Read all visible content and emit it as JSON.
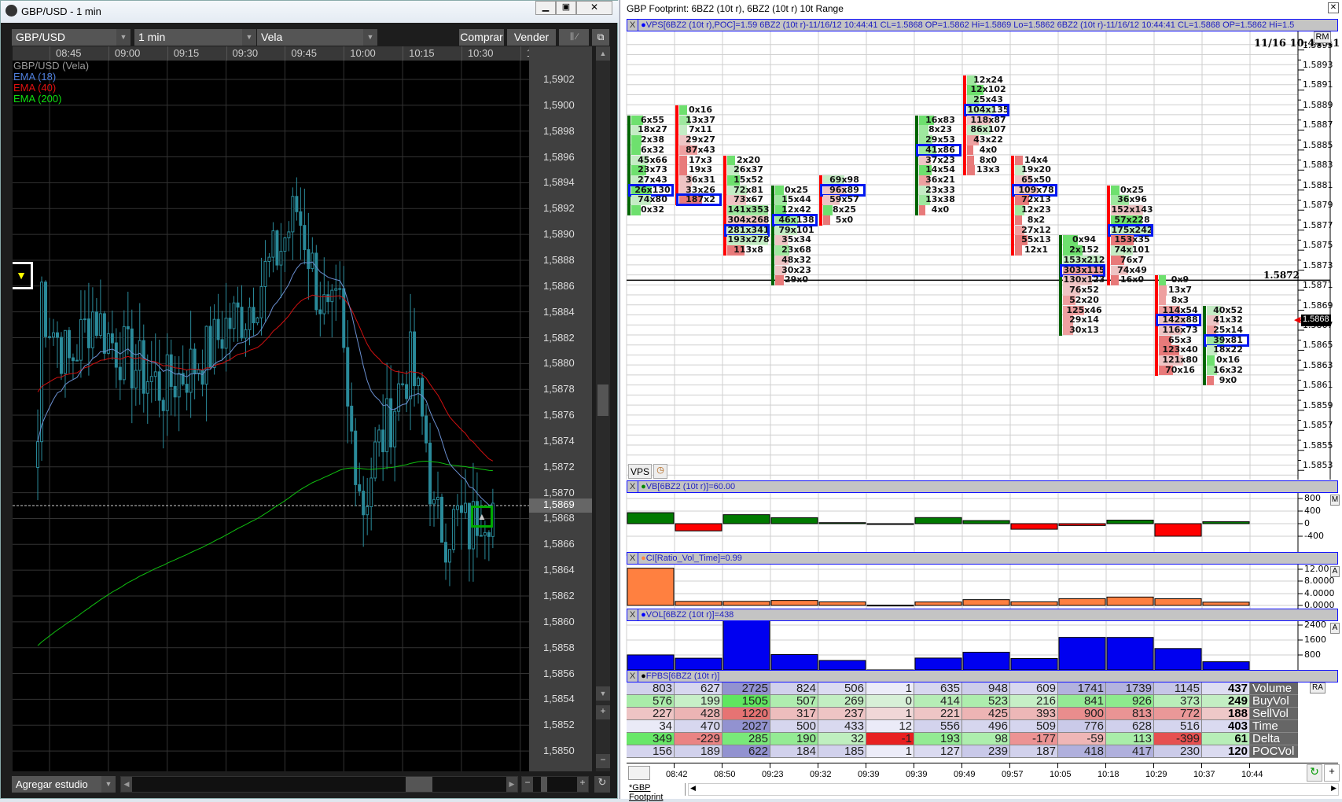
{
  "left_window": {
    "title": "GBP/USD - 1 min",
    "controls": {
      "symbol": "GBP/USD",
      "interval": "1 min",
      "chart_type": "Vela",
      "buy": "Comprar",
      "sell": "Vender"
    },
    "time_labels": [
      "08:45",
      "09:00",
      "09:15",
      "09:30",
      "09:45",
      "10:00",
      "10:15",
      "10:30",
      "10:4"
    ],
    "price_labels": [
      "1,5902",
      "1,5900",
      "1,5898",
      "1,5896",
      "1,5894",
      "1,5892",
      "1,5890",
      "1,5888",
      "1,5886",
      "1,5884",
      "1,5882",
      "1,5880",
      "1,5878",
      "1,5876",
      "1,5874",
      "1,5872",
      "1,5870",
      "1,5868",
      "1,5866",
      "1,5864",
      "1,5862",
      "1,5860",
      "1,5858",
      "1,5856",
      "1,5854",
      "1,5852",
      "1,5850"
    ],
    "current_price": "1,5869",
    "legend": [
      {
        "label": "GBP/USD (Vela)",
        "color": "#9a9a9a"
      },
      {
        "label": "EMA (18)",
        "color": "#4f7fdc"
      },
      {
        "label": "EMA (40)",
        "color": "#e01010"
      },
      {
        "label": "EMA (200)",
        "color": "#10e010"
      }
    ],
    "price_path": [
      [
        "08:42",
        1.5874
      ],
      [
        "08:43",
        1.5886
      ],
      [
        "08:44",
        1.5884
      ],
      [
        "08:47",
        1.5882
      ],
      [
        "08:50",
        1.588
      ],
      [
        "08:53",
        1.5882
      ],
      [
        "08:56",
        1.5884
      ],
      [
        "09:00",
        1.5882
      ],
      [
        "09:03",
        1.5881
      ],
      [
        "09:06",
        1.588
      ],
      [
        "09:10",
        1.5879
      ],
      [
        "09:14",
        1.5878
      ],
      [
        "09:18",
        1.5879
      ],
      [
        "09:22",
        1.588
      ],
      [
        "09:26",
        1.5881
      ],
      [
        "09:30",
        1.5883
      ],
      [
        "09:35",
        1.5884
      ],
      [
        "09:40",
        1.5887
      ],
      [
        "09:44",
        1.5889
      ],
      [
        "09:48",
        1.5892
      ],
      [
        "09:50",
        1.589
      ],
      [
        "09:53",
        1.5886
      ],
      [
        "09:56",
        1.5883
      ],
      [
        "09:59",
        1.5884
      ],
      [
        "10:01",
        1.5876
      ],
      [
        "10:03",
        1.5873
      ],
      [
        "10:05",
        1.5869
      ],
      [
        "10:08",
        1.5873
      ],
      [
        "10:11",
        1.5875
      ],
      [
        "10:14",
        1.5878
      ],
      [
        "10:17",
        1.588
      ],
      [
        "10:19",
        1.5877
      ],
      [
        "10:21",
        1.5874
      ],
      [
        "10:23",
        1.5868
      ],
      [
        "10:26",
        1.5867
      ],
      [
        "10:29",
        1.5868
      ],
      [
        "10:32",
        1.5867
      ],
      [
        "10:35",
        1.5869
      ],
      [
        "10:38",
        1.5869
      ]
    ],
    "add_study": "Agregar estudio"
  },
  "right_window": {
    "title": "GBP Footprint: 6BZ2 (10t r), 6BZ2 (10t r) 10t Range",
    "info_strip": "VPS[6BZ2 (10t r),POC]=1.59  6BZ2 (10t r)-11/16/12 10:44:41 CL=1.5868 OP=1.5862 Hi=1.5869 Lo=1.5862  6BZ2 (10t r)-11/16/12 10:44:41 CL=1.5868 OP=1.5862 Hi=1.5",
    "datetime": "11/16 10:44:41",
    "rm": "RM",
    "price_labels": [
      "1.5895",
      "1.5893",
      "1.5891",
      "1.5889",
      "1.5887",
      "1.5885",
      "1.5883",
      "1.5881",
      "1.5879",
      "1.5877",
      "1.5875",
      "1.5873",
      "1.5871",
      "1.5869",
      "1.5867",
      "1.5865",
      "1.5863",
      "1.5861",
      "1.5859",
      "1.5857",
      "1.5855",
      "1.5853"
    ],
    "line_price": "1.5872",
    "current_price": "1.5868",
    "vps_button": "VPS",
    "footprint": [
      {
        "top": 1.5888,
        "dir": "up",
        "poc": 7,
        "cells": [
          "6x55",
          "18x27",
          "2x38",
          "6x32",
          "45x66",
          "23x73",
          "27x43",
          "26x130",
          "74x80",
          "0x32"
        ]
      },
      {
        "top": 1.5889,
        "dir": "down",
        "poc": 9,
        "cells": [
          "0x16",
          "13x37",
          "7x11",
          "29x27",
          "87x43",
          "17x3",
          "19x3",
          "36x31",
          "33x26",
          "187x2"
        ]
      },
      {
        "top": 1.5884,
        "dir": "down",
        "poc": 7,
        "cells": [
          "2x20",
          "26x37",
          "15x52",
          "72x81",
          "73x67",
          "141x353",
          "304x268",
          "281x341",
          "193x278",
          "113x8"
        ]
      },
      {
        "top": 1.5881,
        "dir": "up",
        "poc": 3,
        "cells": [
          "0x25",
          "15x44",
          "12x42",
          "46x138",
          "79x101",
          "35x34",
          "23x68",
          "48x32",
          "30x23",
          "29x0"
        ]
      },
      {
        "top": 1.5882,
        "dir": "down",
        "poc": 1,
        "cells": [
          "69x98",
          "96x89",
          "59x57",
          "8x25",
          "5x0"
        ]
      },
      {
        "top": 1.5872,
        "dir": "none",
        "poc": -1,
        "cells": []
      },
      {
        "top": 1.5888,
        "dir": "up",
        "poc": 3,
        "cells": [
          "16x83",
          "8x23",
          "29x53",
          "41x86",
          "37x23",
          "14x54",
          "36x21",
          "23x33",
          "13x38",
          "4x0"
        ]
      },
      {
        "top": 1.5892,
        "dir": "down",
        "poc": 3,
        "cells": [
          "12x24",
          "12x102",
          "25x43",
          "104x135",
          "118x87",
          "86x107",
          "43x22",
          "4x0",
          "8x0",
          "13x3"
        ]
      },
      {
        "top": 1.5884,
        "dir": "down",
        "poc": 3,
        "cells": [
          "14x4",
          "19x20",
          "65x50",
          "109x78",
          "72x13",
          "12x23",
          "8x2",
          "27x12",
          "55x13",
          "12x1"
        ]
      },
      {
        "top": 1.5876,
        "dir": "up",
        "poc": 3,
        "cells": [
          "0x94",
          "2x152",
          "153x212",
          "303x115",
          "130x123",
          "76x52",
          "52x20",
          "125x46",
          "29x14",
          "30x13"
        ]
      },
      {
        "top": 1.5881,
        "dir": "down",
        "poc": 4,
        "cells": [
          "0x25",
          "36x96",
          "152x143",
          "57x228",
          "175x242",
          "153x35",
          "74x101",
          "76x7",
          "74x49",
          "16x0"
        ]
      },
      {
        "top": 1.5872,
        "dir": "down",
        "poc": 4,
        "cells": [
          "0x9",
          "13x7",
          "8x3",
          "114x54",
          "142x88",
          "116x73",
          "65x3",
          "123x40",
          "121x80",
          "70x16"
        ]
      },
      {
        "top": 1.5869,
        "dir": "up",
        "poc": 3,
        "cells": [
          "40x52",
          "41x32",
          "25x14",
          "39x81",
          "18x22",
          "0x16",
          "16x32",
          "9x0"
        ]
      }
    ],
    "vb": {
      "header": "VB[6BZ2 (10t r)]=60.00",
      "labels": [
        "800",
        "400",
        "0",
        "-400"
      ],
      "badge": "M",
      "values": [
        349,
        -229,
        285,
        190,
        32,
        -1,
        193,
        98,
        -177,
        -59,
        113,
        -399,
        61
      ]
    },
    "ci": {
      "header": "CI[Ratio_Vol_Time]=0.99",
      "labels": [
        "12.00",
        "8.0000",
        "4.0000",
        "0.0000"
      ],
      "badge": "A",
      "values": [
        23.6,
        1.33,
        1.34,
        1.65,
        1.17,
        0.08,
        1.14,
        1.91,
        1.2,
        2.24,
        2.77,
        2.22,
        1.08
      ]
    },
    "vol": {
      "header": "VOL[6BZ2 (10t r)]=438",
      "labels": [
        "2400",
        "1600",
        "800"
      ],
      "badge": "A",
      "values": [
        803,
        627,
        2725,
        824,
        506,
        1,
        635,
        948,
        609,
        1741,
        1739,
        1145,
        437
      ]
    },
    "fpbs": {
      "header": "FPBS[6BZ2 (10t r)]",
      "badge": "RA",
      "rows": [
        {
          "label": "Volume",
          "kind": "vol",
          "values": [
            803,
            627,
            2725,
            824,
            506,
            1,
            635,
            948,
            609,
            1741,
            1739,
            1145,
            437
          ]
        },
        {
          "label": "BuyVol",
          "kind": "buy",
          "values": [
            576,
            199,
            1505,
            507,
            269,
            0,
            414,
            523,
            216,
            841,
            926,
            373,
            249
          ]
        },
        {
          "label": "SellVol",
          "kind": "sell",
          "values": [
            227,
            428,
            1220,
            317,
            237,
            1,
            221,
            425,
            393,
            900,
            813,
            772,
            188
          ]
        },
        {
          "label": "Time",
          "kind": "vol",
          "values": [
            34,
            470,
            2027,
            500,
            433,
            12,
            556,
            496,
            509,
            776,
            628,
            516,
            403
          ]
        },
        {
          "label": "Delta",
          "kind": "delta",
          "values": [
            349,
            -229,
            285,
            190,
            32,
            -1,
            193,
            98,
            -177,
            -59,
            113,
            -399,
            61
          ]
        },
        {
          "label": "POCVol",
          "kind": "vol",
          "values": [
            156,
            189,
            622,
            184,
            185,
            1,
            127,
            239,
            187,
            418,
            417,
            230,
            120
          ]
        }
      ]
    },
    "time_labels": [
      "08:42",
      "08:50",
      "09:23",
      "09:32",
      "09:39",
      "09:39",
      "09:49",
      "09:57",
      "10:05",
      "10:18",
      "10:29",
      "10:37",
      "10:44"
    ],
    "tab": "*GBP Footprint"
  }
}
